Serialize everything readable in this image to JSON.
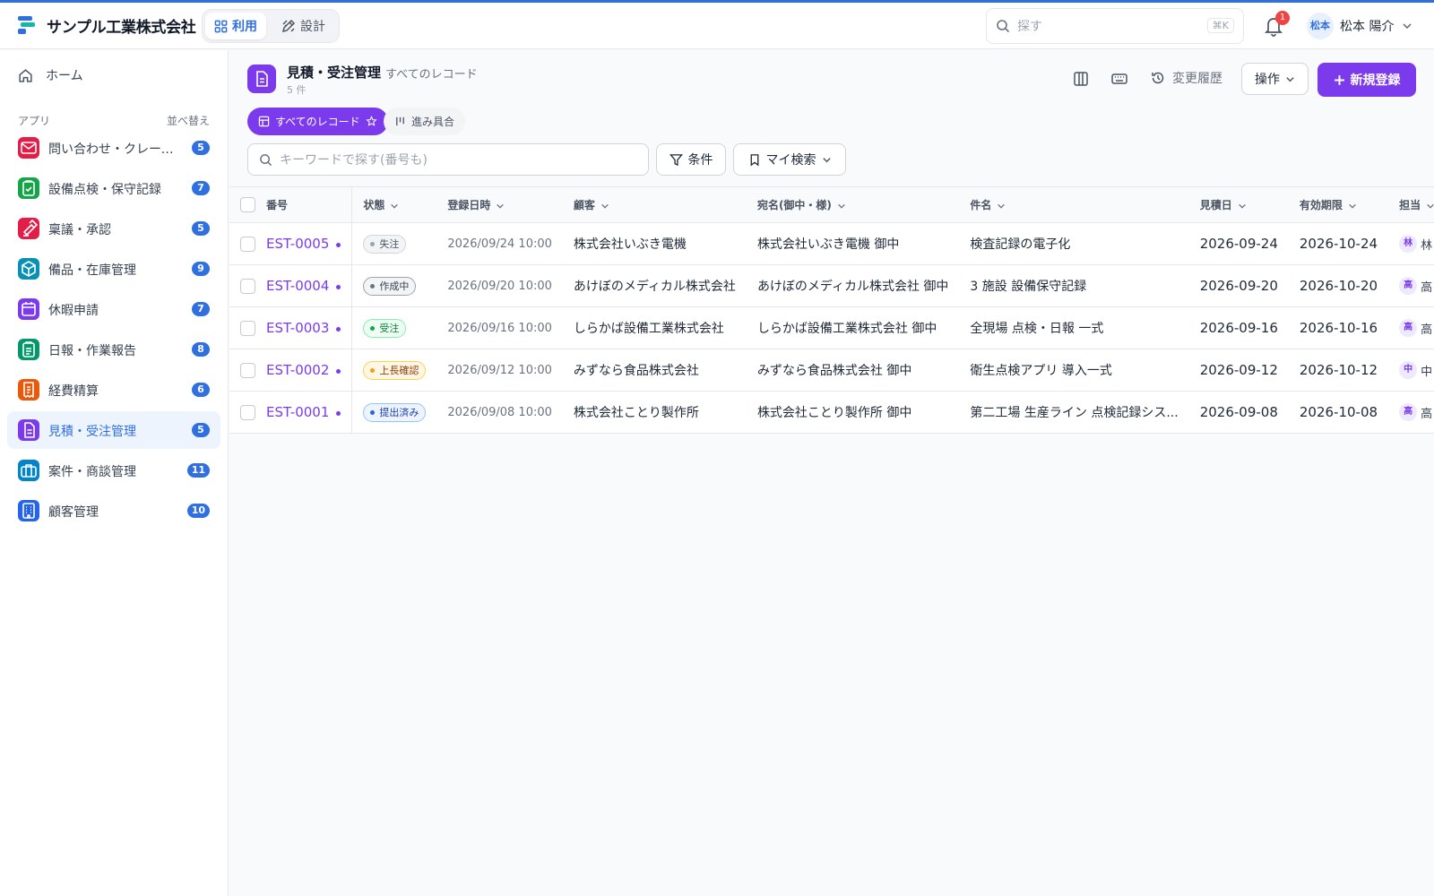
{
  "header": {
    "company": "サンプル工業株式会社",
    "mode_use": "利用",
    "mode_design": "設計",
    "search_placeholder": "探す",
    "search_shortcut": "⌘K",
    "notifications": "1",
    "avatar": "松本",
    "user_name": "松本 陽介"
  },
  "sidebar": {
    "home": "ホーム",
    "apps_label": "アプリ",
    "sort_label": "並べ替え",
    "items": [
      {
        "label": "問い合わせ・クレーム管理",
        "count": "5",
        "color": "#e11d48",
        "icon": "mail-icon"
      },
      {
        "label": "設備点検・保守記録",
        "count": "7",
        "color": "#16a34a",
        "icon": "clipboard-check-icon"
      },
      {
        "label": "稟議・承認",
        "count": "5",
        "color": "#e11d48",
        "icon": "stamp-icon"
      },
      {
        "label": "備品・在庫管理",
        "count": "9",
        "color": "#0891b2",
        "icon": "box-icon"
      },
      {
        "label": "休暇申請",
        "count": "7",
        "color": "#7c3aed",
        "icon": "calendar-icon"
      },
      {
        "label": "日報・作業報告",
        "count": "8",
        "color": "#059669",
        "icon": "clipboard-icon"
      },
      {
        "label": "経費精算",
        "count": "6",
        "color": "#ea580c",
        "icon": "receipt-icon"
      },
      {
        "label": "見積・受注管理",
        "count": "5",
        "color": "#7c3aed",
        "icon": "document-icon"
      },
      {
        "label": "案件・商談管理",
        "count": "11",
        "color": "#0284c7",
        "icon": "briefcase-icon"
      },
      {
        "label": "顧客管理",
        "count": "10",
        "color": "#2563eb",
        "icon": "building-icon"
      }
    ]
  },
  "main": {
    "title": "見積・受注管理",
    "subtitle": "すべてのレコード",
    "count": "5 件",
    "history": "変更履歴",
    "ops": "操作",
    "new": "新規登録",
    "view_all": "すべてのレコード",
    "view_progress": "進み具合",
    "keyword_placeholder": "キーワードで探す(番号も)",
    "filter": "条件",
    "my_search": "マイ検索"
  },
  "table": {
    "columns": [
      "番号",
      "状態",
      "登録日時",
      "顧客",
      "宛名(御中・様)",
      "件名",
      "見積日",
      "有効期限",
      "担当"
    ],
    "rows": [
      {
        "no": "EST-0005",
        "status": "失注",
        "status_color": "#9ca3af",
        "status_bg": "#f3f4f6",
        "status_border": "#d1d5db",
        "status_text": "#4b5563",
        "created": "2026/09/24 10:00",
        "customer": "株式会社いぶき電機",
        "addressee": "株式会社いぶき電機 御中",
        "subject": "検査記録の電子化",
        "quote_date": "2026-09-24",
        "valid_until": "2026-10-24",
        "owner_initial": "林",
        "owner": "林"
      },
      {
        "no": "EST-0004",
        "status": "作成中",
        "status_color": "#6b7280",
        "status_bg": "#f3f4f6",
        "status_border": "#9ca3af",
        "status_text": "#374151",
        "created": "2026/09/20 10:00",
        "customer": "あけぼのメディカル株式会社",
        "addressee": "あけぼのメディカル株式会社 御中",
        "subject": "3 施設 設備保守記録",
        "quote_date": "2026-09-20",
        "valid_until": "2026-10-20",
        "owner_initial": "高",
        "owner": "高"
      },
      {
        "no": "EST-0003",
        "status": "受注",
        "status_color": "#16a34a",
        "status_bg": "#ecfdf3",
        "status_border": "#86efac",
        "status_text": "#15803d",
        "created": "2026/09/16 10:00",
        "customer": "しらかば設備工業株式会社",
        "addressee": "しらかば設備工業株式会社 御中",
        "subject": "全現場 点検・日報 一式",
        "quote_date": "2026-09-16",
        "valid_until": "2026-10-16",
        "owner_initial": "高",
        "owner": "高"
      },
      {
        "no": "EST-0002",
        "status": "上長確認",
        "status_color": "#f59e0b",
        "status_bg": "#fff7e6",
        "status_border": "#fcd34d",
        "status_text": "#92400e",
        "created": "2026/09/12 10:00",
        "customer": "みずなら食品株式会社",
        "addressee": "みずなら食品株式会社 御中",
        "subject": "衛生点検アプリ 導入一式",
        "quote_date": "2026-09-12",
        "valid_until": "2026-10-12",
        "owner_initial": "中",
        "owner": "中"
      },
      {
        "no": "EST-0001",
        "status": "提出済み",
        "status_color": "#2563eb",
        "status_bg": "#eef4ff",
        "status_border": "#93c5fd",
        "status_text": "#1e40af",
        "created": "2026/09/08 10:00",
        "customer": "株式会社ことり製作所",
        "addressee": "株式会社ことり製作所 御中",
        "subject": "第二工場 生産ライン 点検記録シス...",
        "quote_date": "2026-09-08",
        "valid_until": "2026-10-08",
        "owner_initial": "高",
        "owner": "高"
      }
    ]
  }
}
